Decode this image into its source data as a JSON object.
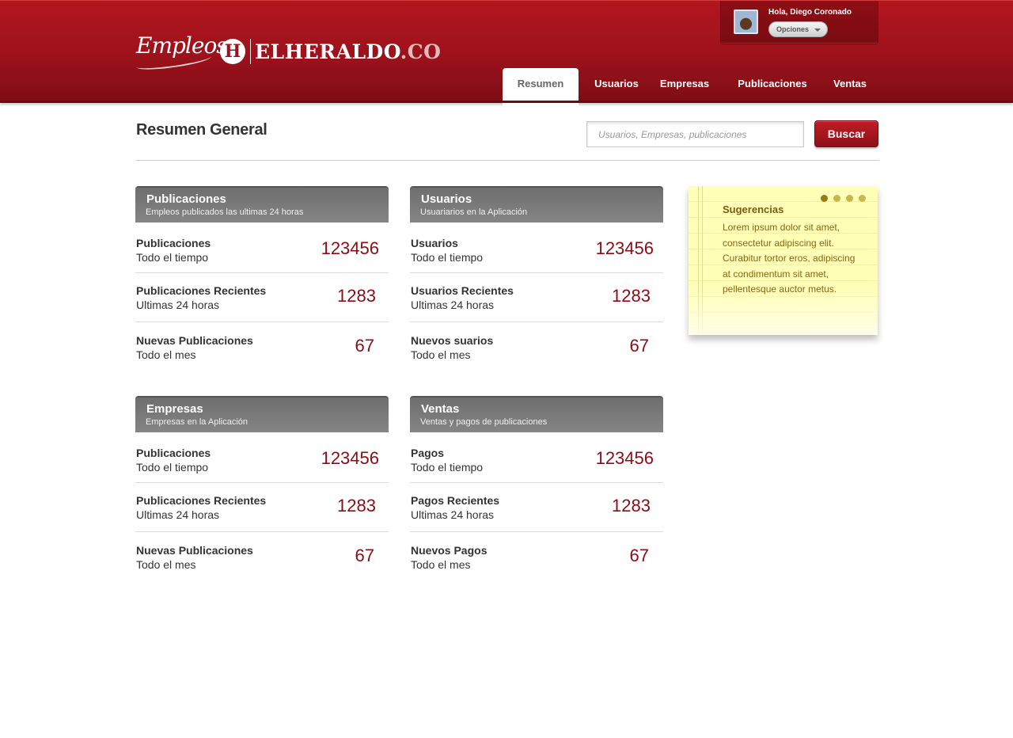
{
  "header": {
    "logo_script": "Empleos",
    "logo_h": "H",
    "logo_brand": "ELHERALDO",
    "logo_tld": ".CO",
    "greeting": "Hola, Diego Coronado",
    "options_label": "Opciones",
    "accent_color": "#a3121c"
  },
  "nav": {
    "tabs": [
      {
        "label": "Resumen",
        "active": true
      },
      {
        "label": "Usuarios",
        "active": false
      },
      {
        "label": "Empresas",
        "active": false
      },
      {
        "label": "Publicaciones",
        "active": false
      },
      {
        "label": "Ventas",
        "active": false
      }
    ]
  },
  "page": {
    "title": "Resumen General",
    "search_placeholder": "Usuarios, Empresas, publicaciones",
    "search_button": "Buscar"
  },
  "panels": [
    {
      "title": "Publicaciones",
      "subtitle": "Empleos publicados las ultimas 24 horas",
      "rows": [
        {
          "label": "Publicaciones",
          "period": "Todo el tiempo",
          "value": "123456"
        },
        {
          "label": "Publicaciones Recientes",
          "period": "Ultimas 24 horas",
          "value": "1283"
        },
        {
          "label": "Nuevas Publicaciones",
          "period": "Todo el mes",
          "value": "67"
        }
      ]
    },
    {
      "title": "Usuarios",
      "subtitle": "Usuariarios en la Aplicación",
      "rows": [
        {
          "label": "Usuarios",
          "period": "Todo el tiempo",
          "value": "123456"
        },
        {
          "label": "Usuarios Recientes",
          "period": "Ultimas 24 horas",
          "value": "1283"
        },
        {
          "label": "Nuevos suarios",
          "period": "Todo el mes",
          "value": "67"
        }
      ]
    },
    {
      "title": "Empresas",
      "subtitle": "Empresas en la Aplicación",
      "rows": [
        {
          "label": "Publicaciones",
          "period": "Todo el tiempo",
          "value": "123456"
        },
        {
          "label": "Publicaciones Recientes",
          "period": "Ultimas 24 horas",
          "value": "1283"
        },
        {
          "label": "Nuevas Publicaciones",
          "period": "Todo el mes",
          "value": "67"
        }
      ]
    },
    {
      "title": "Ventas",
      "subtitle": "Ventas y pagos de publicaciones",
      "rows": [
        {
          "label": "Pagos",
          "period": "Todo el tiempo",
          "value": "123456"
        },
        {
          "label": "Pagos Recientes",
          "period": "Ultimas 24 horas",
          "value": "1283"
        },
        {
          "label": "Nuevos Pagos",
          "period": "Todo el mes",
          "value": "67"
        }
      ]
    }
  ],
  "note": {
    "title": "Sugerencias",
    "body": "Lorem ipsum dolor sit amet, consectetur adipiscing elit. Curabitur tortor eros, adipiscing at condimentum sit amet, pellentesque auctor metus.",
    "pages": 4,
    "active_page": 1
  }
}
